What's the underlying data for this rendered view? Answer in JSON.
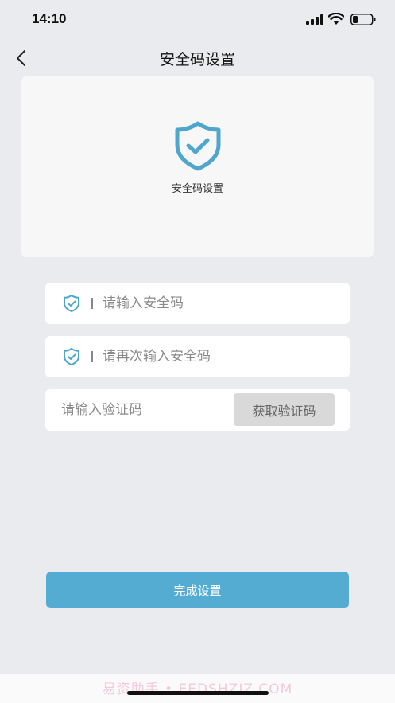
{
  "status_bar": {
    "time": "14:10"
  },
  "nav": {
    "title": "安全码设置",
    "back_icon": "chevron-left-icon"
  },
  "hero": {
    "icon": "shield-check-icon",
    "label": "安全码设置"
  },
  "form": {
    "security_code_placeholder": "请输入安全码",
    "confirm_code_placeholder": "请再次输入安全码",
    "verify_code_placeholder": "请输入验证码",
    "get_code_label": "获取验证码"
  },
  "submit_label": "完成设置",
  "watermark": "易资助手 • EEDSHZIZ.COM",
  "colors": {
    "accent": "#55acd3",
    "shield": "#4fa6cc",
    "background": "#e9ebee"
  }
}
